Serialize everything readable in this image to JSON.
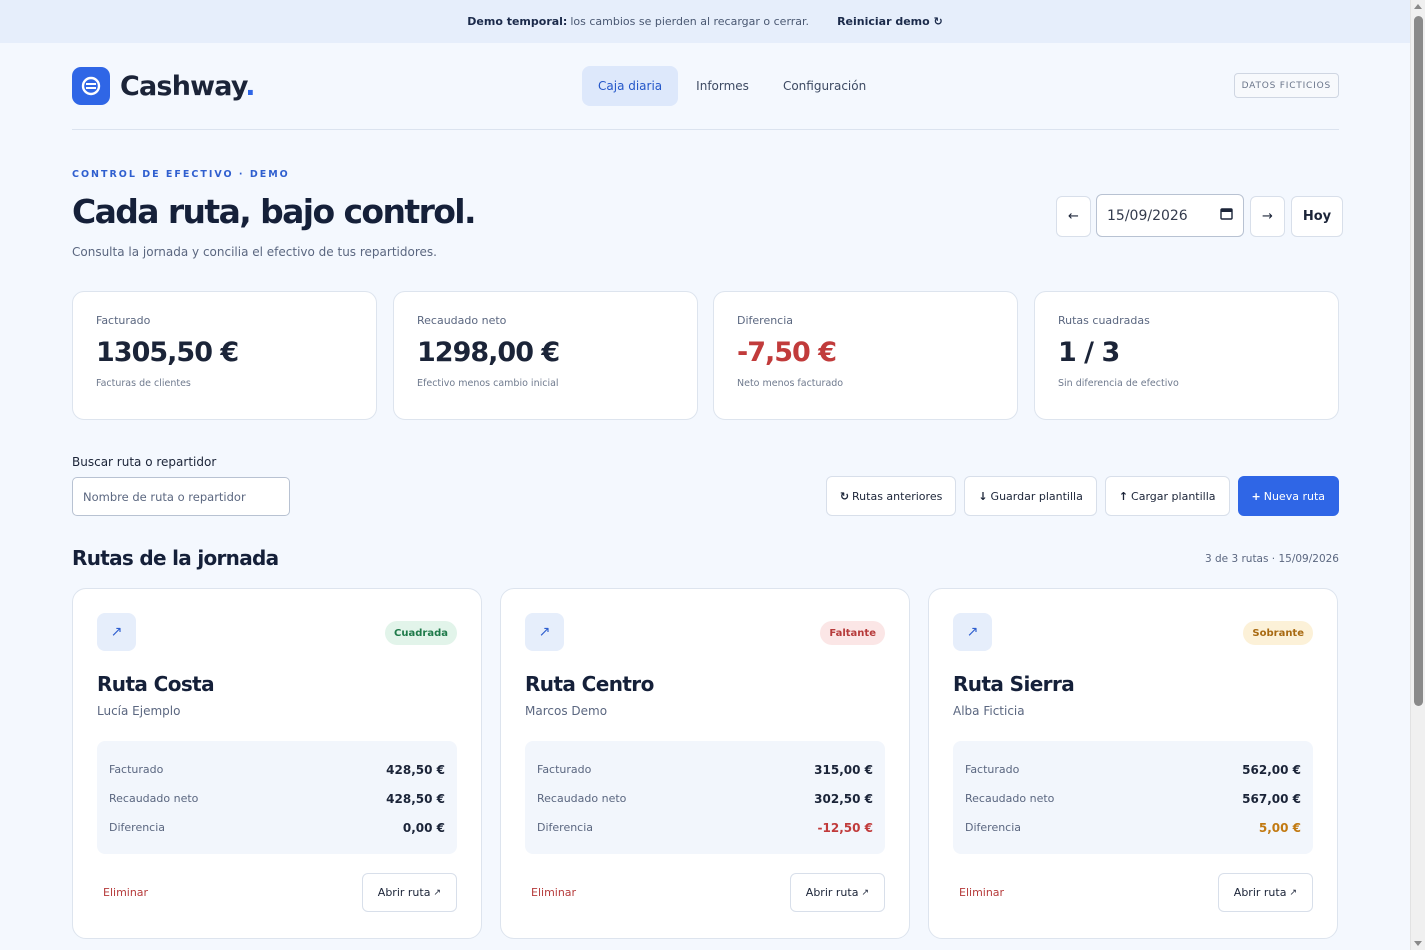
{
  "banner": {
    "strong": "Demo temporal:",
    "text": "los cambios se pierden al recargar o cerrar.",
    "reset": "Reiniciar demo ↻"
  },
  "brand": {
    "name": "Cashway",
    "dot": "."
  },
  "nav": [
    {
      "label": "Caja diaria",
      "active": true
    },
    {
      "label": "Informes",
      "active": false
    },
    {
      "label": "Configuración",
      "active": false
    }
  ],
  "fake_badge": "DATOS FICTICIOS",
  "eyebrow": "CONTROL DE EFECTIVO · DEMO",
  "title": "Cada ruta, bajo control.",
  "subtitle": "Consulta la jornada y concilia el efectivo de tus repartidores.",
  "date": {
    "prev": "←",
    "value": "15/09/2026",
    "next": "→",
    "today": "Hoy"
  },
  "kpis": [
    {
      "label": "Facturado",
      "value": "1305,50 €",
      "hint": "Facturas de clientes"
    },
    {
      "label": "Recaudado neto",
      "value": "1298,00 €",
      "hint": "Efectivo menos cambio inicial"
    },
    {
      "label": "Diferencia",
      "value": "-7,50 €",
      "hint": "Neto menos facturado"
    },
    {
      "label": "Rutas cuadradas",
      "value": "1 / 3",
      "hint": "Sin diferencia de efectivo"
    }
  ],
  "search": {
    "label": "Buscar ruta o repartidor",
    "placeholder": "Nombre de ruta o repartidor"
  },
  "actions": [
    {
      "icon": "↻",
      "label": "Rutas anteriores"
    },
    {
      "icon": "↓",
      "label": "Guardar plantilla"
    },
    {
      "icon": "↑",
      "label": "Cargar plantilla"
    },
    {
      "icon": "+",
      "label": "Nueva ruta"
    }
  ],
  "section": {
    "title": "Rutas de la jornada",
    "meta": "3 de 3 rutas · 15/09/2026"
  },
  "routes": [
    {
      "status": "Cuadrada",
      "name": "Ruta Costa",
      "driver": "Lucía Ejemplo",
      "stats": [
        {
          "label": "Facturado",
          "value": "428,50 €"
        },
        {
          "label": "Recaudado neto",
          "value": "428,50 €"
        },
        {
          "label": "Diferencia",
          "value": "0,00 €"
        }
      ],
      "delete": "Eliminar",
      "open": "Abrir ruta",
      "open_icon": "↗"
    },
    {
      "status": "Faltante",
      "name": "Ruta Centro",
      "driver": "Marcos Demo",
      "stats": [
        {
          "label": "Facturado",
          "value": "315,00 €"
        },
        {
          "label": "Recaudado neto",
          "value": "302,50 €"
        },
        {
          "label": "Diferencia",
          "value": "-12,50 €"
        }
      ],
      "delete": "Eliminar",
      "open": "Abrir ruta",
      "open_icon": "↗"
    },
    {
      "status": "Sobrante",
      "name": "Ruta Sierra",
      "driver": "Alba Ficticia",
      "stats": [
        {
          "label": "Facturado",
          "value": "562,00 €"
        },
        {
          "label": "Recaudado neto",
          "value": "567,00 €"
        },
        {
          "label": "Diferencia",
          "value": "5,00 €"
        }
      ],
      "delete": "Eliminar",
      "open": "Abrir ruta",
      "open_icon": "↗"
    }
  ],
  "colors": {
    "accent": "#2f66e6",
    "negative": "#c13b3b",
    "surplus": "#c27a12",
    "ok": "#1f7a4a"
  }
}
